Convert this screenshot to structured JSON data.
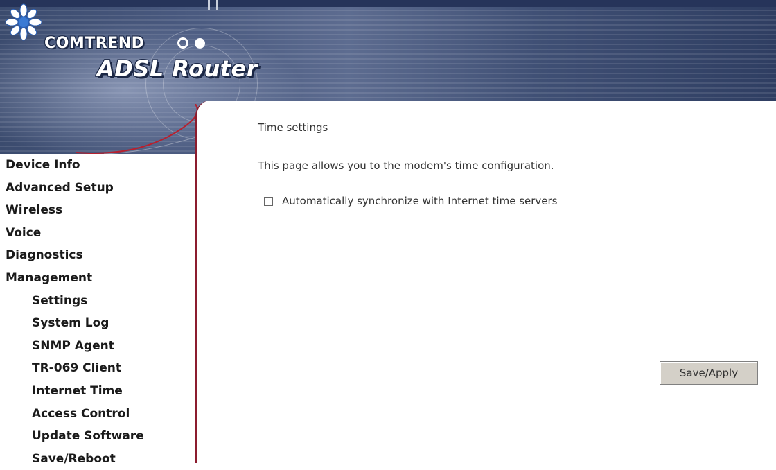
{
  "header": {
    "brand": "COMTREND",
    "product": "ADSL Router",
    "logo_icon": "flower-logo-icon",
    "colors": {
      "banner_dark": "#2f3e62",
      "banner_light": "#5d6c90",
      "accent": "#8c1c2e"
    }
  },
  "nav": {
    "items": [
      {
        "label": "Device Info",
        "level": 0
      },
      {
        "label": "Advanced Setup",
        "level": 0
      },
      {
        "label": "Wireless",
        "level": 0
      },
      {
        "label": "Voice",
        "level": 0
      },
      {
        "label": "Diagnostics",
        "level": 0
      },
      {
        "label": "Management",
        "level": 0
      },
      {
        "label": "Settings",
        "level": 1
      },
      {
        "label": "System Log",
        "level": 1
      },
      {
        "label": "SNMP Agent",
        "level": 1
      },
      {
        "label": "TR-069 Client",
        "level": 1
      },
      {
        "label": "Internet Time",
        "level": 1
      },
      {
        "label": "Access Control",
        "level": 1
      },
      {
        "label": "Update Software",
        "level": 1
      },
      {
        "label": "Save/Reboot",
        "level": 1
      }
    ]
  },
  "main": {
    "title": "Time settings",
    "description": "This page allows you to the modem's time configuration.",
    "sync_checkbox": {
      "label": "Automatically synchronize with Internet time servers",
      "checked": false
    },
    "save_button": "Save/Apply"
  }
}
